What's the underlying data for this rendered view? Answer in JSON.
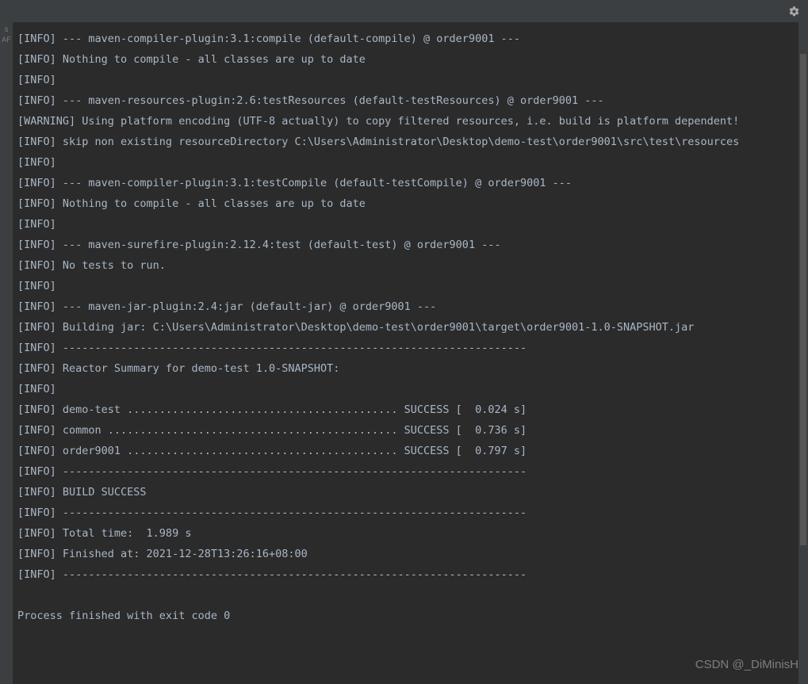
{
  "gutter": {
    "line1": "s",
    "line2": "AF"
  },
  "log_lines": [
    "[INFO] --- maven-compiler-plugin:3.1:compile (default-compile) @ order9001 ---",
    "[INFO] Nothing to compile - all classes are up to date",
    "[INFO]",
    "[INFO] --- maven-resources-plugin:2.6:testResources (default-testResources) @ order9001 ---",
    "[WARNING] Using platform encoding (UTF-8 actually) to copy filtered resources, i.e. build is platform dependent!",
    "[INFO] skip non existing resourceDirectory C:\\Users\\Administrator\\Desktop\\demo-test\\order9001\\src\\test\\resources",
    "[INFO]",
    "[INFO] --- maven-compiler-plugin:3.1:testCompile (default-testCompile) @ order9001 ---",
    "[INFO] Nothing to compile - all classes are up to date",
    "[INFO]",
    "[INFO] --- maven-surefire-plugin:2.12.4:test (default-test) @ order9001 ---",
    "[INFO] No tests to run.",
    "[INFO]",
    "[INFO] --- maven-jar-plugin:2.4:jar (default-jar) @ order9001 ---",
    "[INFO] Building jar: C:\\Users\\Administrator\\Desktop\\demo-test\\order9001\\target\\order9001-1.0-SNAPSHOT.jar",
    "[INFO] ------------------------------------------------------------------------",
    "[INFO] Reactor Summary for demo-test 1.0-SNAPSHOT:",
    "[INFO]",
    "[INFO] demo-test .......................................... SUCCESS [  0.024 s]",
    "[INFO] common ............................................. SUCCESS [  0.736 s]",
    "[INFO] order9001 .......................................... SUCCESS [  0.797 s]",
    "[INFO] ------------------------------------------------------------------------",
    "[INFO] BUILD SUCCESS",
    "[INFO] ------------------------------------------------------------------------",
    "[INFO] Total time:  1.989 s",
    "[INFO] Finished at: 2021-12-28T13:26:16+08:00",
    "[INFO] ------------------------------------------------------------------------",
    "",
    "Process finished with exit code 0"
  ],
  "watermark": "CSDN @_DiMinisH"
}
